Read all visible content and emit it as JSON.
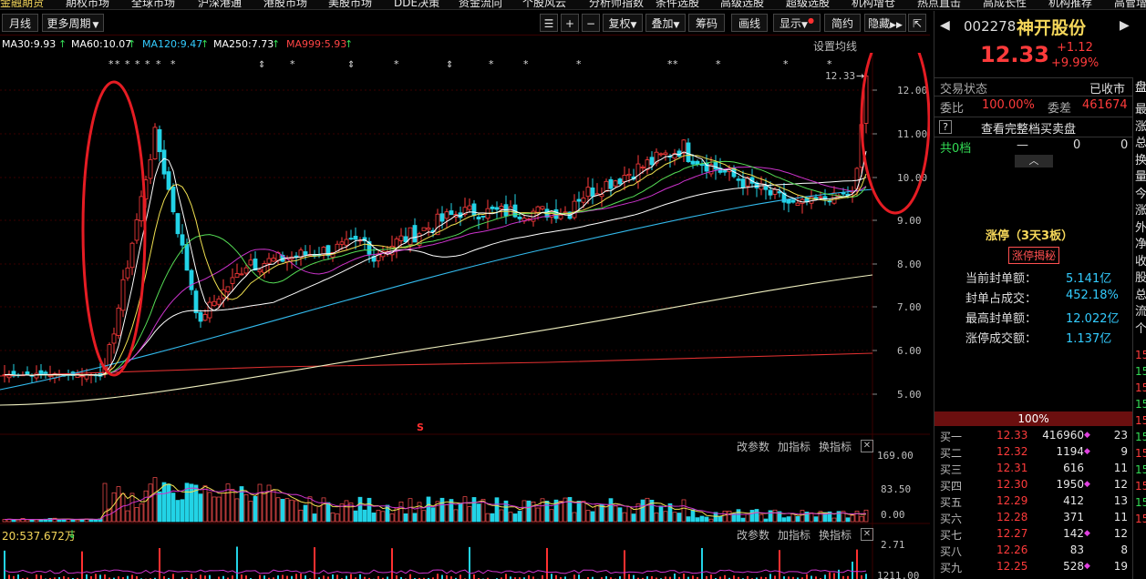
{
  "top_menu": {
    "items": [
      "金融期货",
      "期权市场",
      "全球市场",
      "沪深港通",
      "港股市场",
      "美股市场",
      "DDE决策",
      "资金流向",
      "个股风云",
      "分析师指数",
      "条件选股",
      "高级选股",
      "超级选股",
      "机构增仓",
      "热点直击",
      "高成长性",
      "机构推荐",
      "高管增"
    ]
  },
  "toolbar": {
    "month": "月线",
    "more_period": "更多周期",
    "plus": "+",
    "minus": "−",
    "restore": "复权",
    "overlay": "叠加",
    "chips": "筹码",
    "draw": "画线",
    "display": "显示",
    "brief": "简约",
    "hide": "隐藏",
    "restore_icon": "⇱"
  },
  "ma_line": {
    "ma30": "MA30:9.93",
    "ma60": "MA60:10.07",
    "ma120": "MA120:9.47",
    "ma250": "MA250:7.73",
    "ma999": "MA999:5.93",
    "settings": "设置均线",
    "ma30_color": "#ffffff",
    "ma60_color": "#ffffff",
    "ma120_color": "#33ccff",
    "ma250_color": "#ffffff",
    "ma999_color": "#ff4444"
  },
  "price_axis": {
    "labels": [
      "12.00",
      "11.00",
      "10.00",
      "9.00",
      "8.00",
      "7.00",
      "6.00",
      "5.00"
    ],
    "current_tag": "12.33"
  },
  "markers": {
    "stars": [
      "*",
      "*",
      "*",
      "*",
      "*",
      "*",
      "*",
      "*",
      "*",
      "*",
      "*",
      "*",
      "*",
      "*",
      "*",
      "*",
      "*"
    ],
    "arrows": [
      "⇕",
      "⇕",
      "⇕"
    ],
    "s_mark": "S"
  },
  "volume_panel": {
    "change_params": "改参数",
    "add_indicator": "加指标",
    "switch_indicator": "换指标",
    "close": "✕",
    "axis": [
      "169.00",
      "83.50",
      "0.00"
    ]
  },
  "indicator_panel": {
    "change_params": "改参数",
    "add_indicator": "加指标",
    "switch_indicator": "换指标",
    "close": "✕",
    "label": "20:537.672万",
    "arrow": "↓",
    "axis": [
      "2.71",
      "1211.00"
    ]
  },
  "stock": {
    "code": "002278",
    "name": "神开股份",
    "price": "12.33",
    "change": "+1.12",
    "change_pct": "+9.99%",
    "prev": "◀",
    "next": "▶"
  },
  "trade": {
    "status_label": "交易状态",
    "status_value": "已收市",
    "ratio_label": "委比",
    "ratio_value": "100.00%",
    "diff_label": "委差",
    "diff_value": "461674",
    "help": "?",
    "full_book": "查看完整档买卖盘",
    "total_levels": "共0档",
    "dash": "—",
    "zero1": "0",
    "zero2": "0",
    "up_arrow": "︿"
  },
  "limit_up": {
    "title": "涨停（3天3板）",
    "reveal": "涨停揭秘",
    "rows": [
      {
        "label": "当前封单额：",
        "value": "5.141亿"
      },
      {
        "label": "封单占成交：",
        "value": "452.18%"
      },
      {
        "label": "最高封单额：",
        "value": "12.022亿"
      },
      {
        "label": "涨停成交额：",
        "value": "1.137亿"
      }
    ]
  },
  "bid": {
    "pct": "100%",
    "rows": [
      {
        "name": "买一",
        "price": "12.33",
        "vol": "416960",
        "cnt": "23",
        "dot": "◆"
      },
      {
        "name": "买二",
        "price": "12.32",
        "vol": "1194",
        "cnt": "9",
        "dot": "◆"
      },
      {
        "name": "买三",
        "price": "12.31",
        "vol": "616",
        "cnt": "11",
        "dot": ""
      },
      {
        "name": "买四",
        "price": "12.30",
        "vol": "1950",
        "cnt": "12",
        "dot": "◆"
      },
      {
        "name": "买五",
        "price": "12.29",
        "vol": "412",
        "cnt": "13",
        "dot": ""
      },
      {
        "name": "买六",
        "price": "12.28",
        "vol": "371",
        "cnt": "11",
        "dot": ""
      },
      {
        "name": "买七",
        "price": "12.27",
        "vol": "142",
        "cnt": "12",
        "dot": "◆"
      },
      {
        "name": "买八",
        "price": "12.26",
        "vol": "83",
        "cnt": "8",
        "dot": ""
      },
      {
        "name": "买九",
        "price": "12.25",
        "vol": "528",
        "cnt": "19",
        "dot": "◆"
      }
    ]
  },
  "edge_tab": {
    "label": "盘",
    "chars": [
      "最",
      "涨",
      "总",
      "换",
      "量",
      "今",
      "涨",
      "外",
      "净",
      "收",
      "股",
      "总",
      "流",
      "个"
    ],
    "nums": [
      "15",
      "15",
      "15",
      "15",
      "15",
      "15",
      "15",
      "15",
      "15",
      "15",
      "15"
    ]
  },
  "colors": {
    "up": "#ff3b3b",
    "down": "#22d3e6",
    "accent_yellow": "#f5d75a",
    "annotation_red": "#e51c23"
  }
}
